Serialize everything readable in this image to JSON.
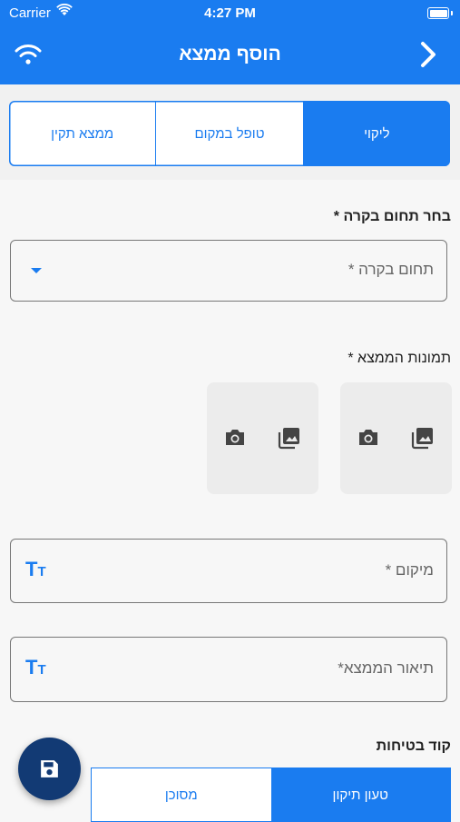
{
  "status_bar": {
    "carrier": "Carrier",
    "time": "4:27 PM"
  },
  "header": {
    "title": "הוסף ממצא"
  },
  "finding_type": {
    "options": [
      "ממצא תקין",
      "טופל במקום",
      "ליקוי"
    ],
    "selected": "ליקוי"
  },
  "domain_section": {
    "label": "בחר תחום בקרה *",
    "placeholder": "תחום בקרה *"
  },
  "photos_section": {
    "label": "תמונות הממצא *"
  },
  "location_field": {
    "placeholder": "מיקום *"
  },
  "description_field": {
    "placeholder": "תיאור הממצא*"
  },
  "safety_code": {
    "label": "קוד בטיחות",
    "options": [
      "מסוכן",
      "טעון תיקון"
    ],
    "selected": "טעון תיקון"
  },
  "text_format_icon": {
    "big": "T",
    "small": "T"
  },
  "colors": {
    "primary": "#1a7cf0",
    "fab": "#123a74"
  }
}
